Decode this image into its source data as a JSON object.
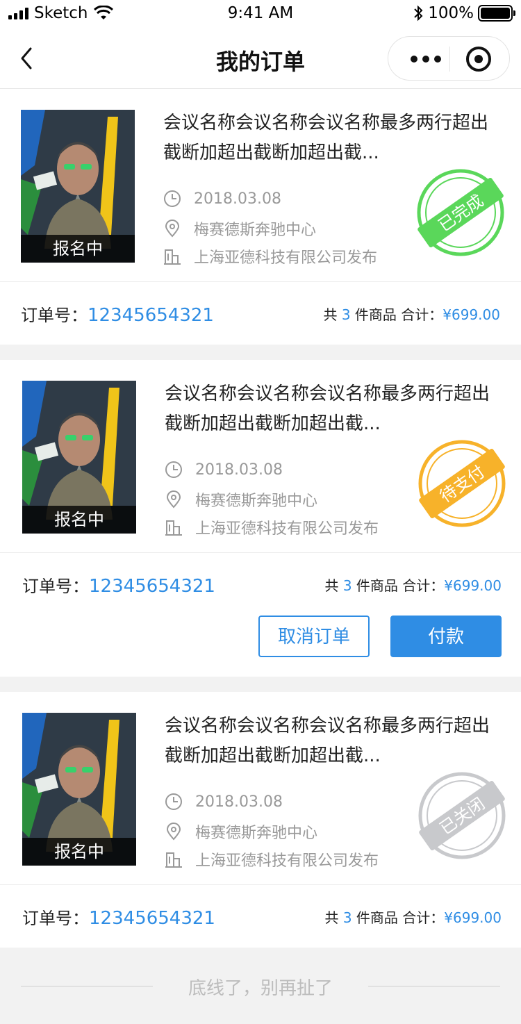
{
  "status_bar": {
    "carrier": "Sketch",
    "time": "9:41 AM",
    "battery_pct": "100%"
  },
  "nav": {
    "title": "我的订单"
  },
  "orders": [
    {
      "poster_label": "报名中",
      "title": "会议名称会议名称会议名称最多两行超出截断加超出截断加超出截...",
      "date": "2018.03.08",
      "location": "梅赛德斯奔驰中心",
      "publisher": "上海亚德科技有限公司发布",
      "status": "已完成",
      "status_color": "#5ad75a",
      "order_label": "订单号：",
      "order_no": "12345654321",
      "summary_prefix": "共 ",
      "count": "3",
      "summary_mid": " 件商品  合计：",
      "total": "¥699.00"
    },
    {
      "poster_label": "报名中",
      "title": "会议名称会议名称会议名称最多两行超出截断加超出截断加超出截...",
      "date": "2018.03.08",
      "location": "梅赛德斯奔驰中心",
      "publisher": "上海亚德科技有限公司发布",
      "status": "待支付",
      "status_color": "#f7b22a",
      "order_label": "订单号：",
      "order_no": "12345654321",
      "summary_prefix": "共 ",
      "count": "3",
      "summary_mid": " 件商品  合计：",
      "total": "¥699.00",
      "actions": {
        "cancel": "取消订单",
        "pay": "付款"
      }
    },
    {
      "poster_label": "报名中",
      "title": "会议名称会议名称会议名称最多两行超出截断加超出截断加超出截...",
      "date": "2018.03.08",
      "location": "梅赛德斯奔驰中心",
      "publisher": "上海亚德科技有限公司发布",
      "status": "已关闭",
      "status_color": "#c8c9cc",
      "order_label": "订单号：",
      "order_no": "12345654321",
      "summary_prefix": "共 ",
      "count": "3",
      "summary_mid": " 件商品  合计：",
      "total": "¥699.00"
    }
  ],
  "footer": {
    "end_text": "底线了，别再扯了"
  },
  "colors": {
    "accent": "#2f8de4"
  }
}
